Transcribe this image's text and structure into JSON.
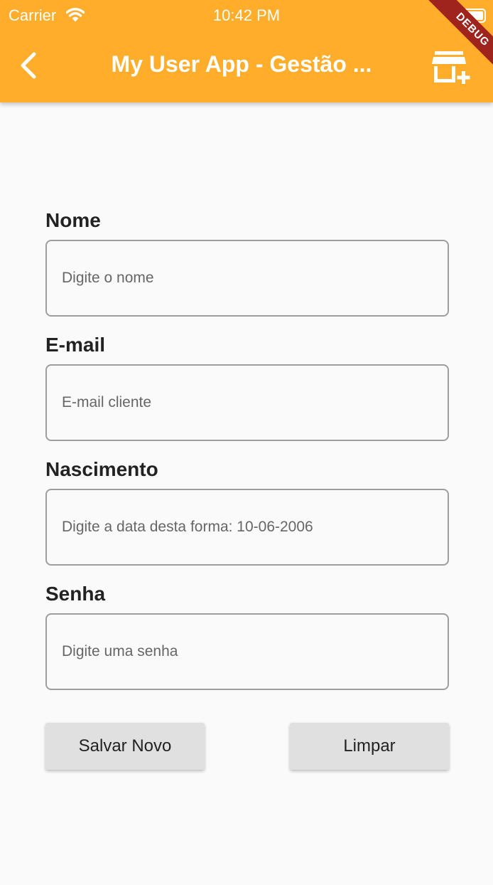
{
  "status_bar": {
    "carrier": "Carrier",
    "time": "10:42 PM"
  },
  "app_bar": {
    "title": "My User App - Gestão ...",
    "back_icon": "chevron-left-icon",
    "action_icon": "add-store-icon",
    "debug_label": "DEBUG",
    "color": "#ffad2b"
  },
  "form": {
    "name": {
      "label": "Nome",
      "placeholder": "Digite o nome",
      "value": ""
    },
    "email": {
      "label": "E-mail",
      "placeholder": "E-mail cliente",
      "value": ""
    },
    "birth": {
      "label": "Nascimento",
      "placeholder": "Digite a data desta forma: 10-06-2006",
      "value": ""
    },
    "password": {
      "label": "Senha",
      "placeholder": "Digite uma senha",
      "value": ""
    }
  },
  "actions": {
    "save_label": "Salvar Novo",
    "clear_label": "Limpar"
  }
}
